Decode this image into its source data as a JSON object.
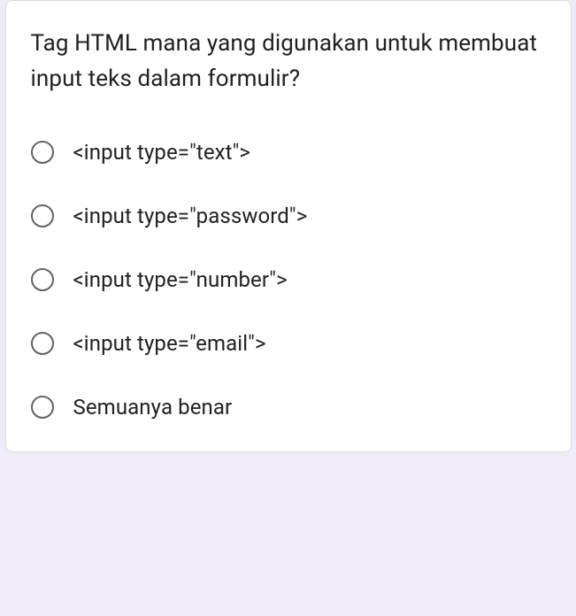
{
  "question": "Tag HTML mana yang digunakan untuk membuat input teks dalam formulir?",
  "options": [
    {
      "label": "<input type=\"text\">"
    },
    {
      "label": "<input type=\"password\">"
    },
    {
      "label": "<input type=\"number\">"
    },
    {
      "label": "<input type=\"email\">"
    },
    {
      "label": "Semuanya benar"
    }
  ]
}
